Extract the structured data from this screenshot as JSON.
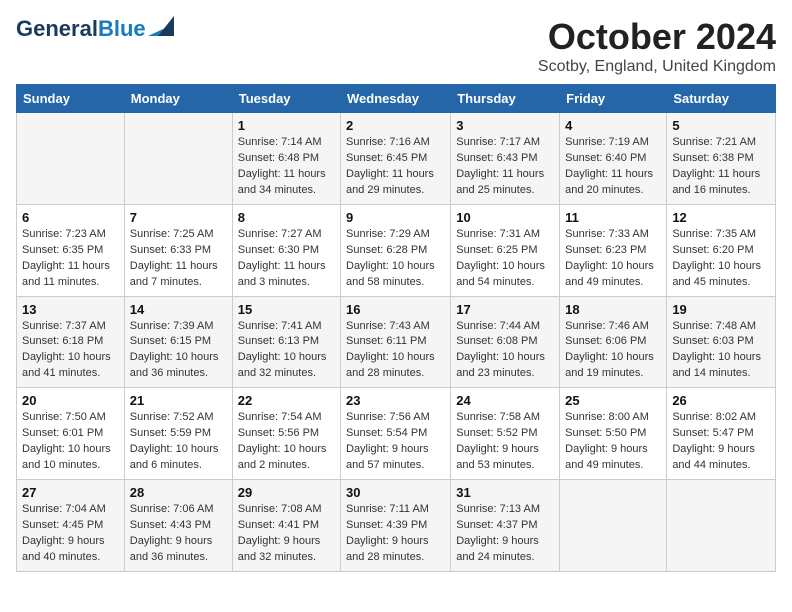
{
  "header": {
    "logo_line1": "General",
    "logo_line2": "Blue",
    "month": "October 2024",
    "location": "Scotby, England, United Kingdom"
  },
  "days_of_week": [
    "Sunday",
    "Monday",
    "Tuesday",
    "Wednesday",
    "Thursday",
    "Friday",
    "Saturday"
  ],
  "weeks": [
    [
      {
        "day": "",
        "info": ""
      },
      {
        "day": "",
        "info": ""
      },
      {
        "day": "1",
        "info": "Sunrise: 7:14 AM\nSunset: 6:48 PM\nDaylight: 11 hours and 34 minutes."
      },
      {
        "day": "2",
        "info": "Sunrise: 7:16 AM\nSunset: 6:45 PM\nDaylight: 11 hours and 29 minutes."
      },
      {
        "day": "3",
        "info": "Sunrise: 7:17 AM\nSunset: 6:43 PM\nDaylight: 11 hours and 25 minutes."
      },
      {
        "day": "4",
        "info": "Sunrise: 7:19 AM\nSunset: 6:40 PM\nDaylight: 11 hours and 20 minutes."
      },
      {
        "day": "5",
        "info": "Sunrise: 7:21 AM\nSunset: 6:38 PM\nDaylight: 11 hours and 16 minutes."
      }
    ],
    [
      {
        "day": "6",
        "info": "Sunrise: 7:23 AM\nSunset: 6:35 PM\nDaylight: 11 hours and 11 minutes."
      },
      {
        "day": "7",
        "info": "Sunrise: 7:25 AM\nSunset: 6:33 PM\nDaylight: 11 hours and 7 minutes."
      },
      {
        "day": "8",
        "info": "Sunrise: 7:27 AM\nSunset: 6:30 PM\nDaylight: 11 hours and 3 minutes."
      },
      {
        "day": "9",
        "info": "Sunrise: 7:29 AM\nSunset: 6:28 PM\nDaylight: 10 hours and 58 minutes."
      },
      {
        "day": "10",
        "info": "Sunrise: 7:31 AM\nSunset: 6:25 PM\nDaylight: 10 hours and 54 minutes."
      },
      {
        "day": "11",
        "info": "Sunrise: 7:33 AM\nSunset: 6:23 PM\nDaylight: 10 hours and 49 minutes."
      },
      {
        "day": "12",
        "info": "Sunrise: 7:35 AM\nSunset: 6:20 PM\nDaylight: 10 hours and 45 minutes."
      }
    ],
    [
      {
        "day": "13",
        "info": "Sunrise: 7:37 AM\nSunset: 6:18 PM\nDaylight: 10 hours and 41 minutes."
      },
      {
        "day": "14",
        "info": "Sunrise: 7:39 AM\nSunset: 6:15 PM\nDaylight: 10 hours and 36 minutes."
      },
      {
        "day": "15",
        "info": "Sunrise: 7:41 AM\nSunset: 6:13 PM\nDaylight: 10 hours and 32 minutes."
      },
      {
        "day": "16",
        "info": "Sunrise: 7:43 AM\nSunset: 6:11 PM\nDaylight: 10 hours and 28 minutes."
      },
      {
        "day": "17",
        "info": "Sunrise: 7:44 AM\nSunset: 6:08 PM\nDaylight: 10 hours and 23 minutes."
      },
      {
        "day": "18",
        "info": "Sunrise: 7:46 AM\nSunset: 6:06 PM\nDaylight: 10 hours and 19 minutes."
      },
      {
        "day": "19",
        "info": "Sunrise: 7:48 AM\nSunset: 6:03 PM\nDaylight: 10 hours and 14 minutes."
      }
    ],
    [
      {
        "day": "20",
        "info": "Sunrise: 7:50 AM\nSunset: 6:01 PM\nDaylight: 10 hours and 10 minutes."
      },
      {
        "day": "21",
        "info": "Sunrise: 7:52 AM\nSunset: 5:59 PM\nDaylight: 10 hours and 6 minutes."
      },
      {
        "day": "22",
        "info": "Sunrise: 7:54 AM\nSunset: 5:56 PM\nDaylight: 10 hours and 2 minutes."
      },
      {
        "day": "23",
        "info": "Sunrise: 7:56 AM\nSunset: 5:54 PM\nDaylight: 9 hours and 57 minutes."
      },
      {
        "day": "24",
        "info": "Sunrise: 7:58 AM\nSunset: 5:52 PM\nDaylight: 9 hours and 53 minutes."
      },
      {
        "day": "25",
        "info": "Sunrise: 8:00 AM\nSunset: 5:50 PM\nDaylight: 9 hours and 49 minutes."
      },
      {
        "day": "26",
        "info": "Sunrise: 8:02 AM\nSunset: 5:47 PM\nDaylight: 9 hours and 44 minutes."
      }
    ],
    [
      {
        "day": "27",
        "info": "Sunrise: 7:04 AM\nSunset: 4:45 PM\nDaylight: 9 hours and 40 minutes."
      },
      {
        "day": "28",
        "info": "Sunrise: 7:06 AM\nSunset: 4:43 PM\nDaylight: 9 hours and 36 minutes."
      },
      {
        "day": "29",
        "info": "Sunrise: 7:08 AM\nSunset: 4:41 PM\nDaylight: 9 hours and 32 minutes."
      },
      {
        "day": "30",
        "info": "Sunrise: 7:11 AM\nSunset: 4:39 PM\nDaylight: 9 hours and 28 minutes."
      },
      {
        "day": "31",
        "info": "Sunrise: 7:13 AM\nSunset: 4:37 PM\nDaylight: 9 hours and 24 minutes."
      },
      {
        "day": "",
        "info": ""
      },
      {
        "day": "",
        "info": ""
      }
    ]
  ]
}
